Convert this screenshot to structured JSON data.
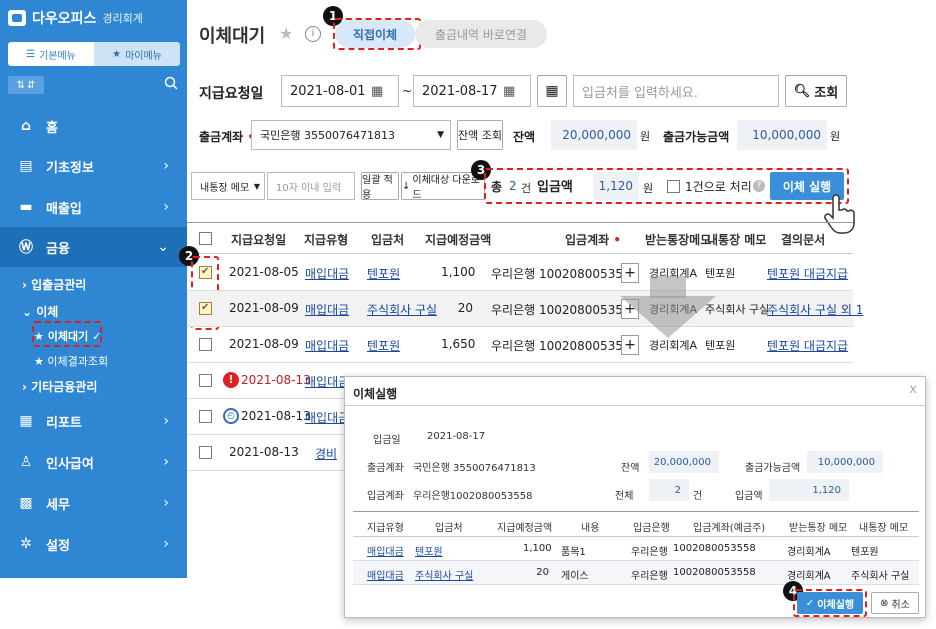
{
  "sidebar": {
    "brand": "다우오피스",
    "brand_sub": "경리회계",
    "tab_basic": "기본메뉴",
    "tab_my": "마이메뉴",
    "nav": [
      {
        "label": "홈",
        "icon": "home-icon"
      },
      {
        "label": "기초정보",
        "icon": "list-icon"
      },
      {
        "label": "매출입",
        "icon": "card-icon"
      },
      {
        "label": "금융",
        "icon": "won-icon"
      },
      {
        "label": "리포트",
        "icon": "report-icon"
      },
      {
        "label": "인사급여",
        "icon": "person-icon"
      },
      {
        "label": "세무",
        "icon": "calculator-icon"
      },
      {
        "label": "설정",
        "icon": "gear-icon"
      }
    ],
    "sub_deposit": "입출금관리",
    "sub_transfer": "이체",
    "sub_transfer_wait": "이체대기",
    "sub_transfer_result": "이체결과조회",
    "sub_other": "기타금융관리"
  },
  "header": {
    "title": "이체대기",
    "tab_direct": "직접이체",
    "tab_history": "출금내역 바로연결"
  },
  "filters": {
    "date_label": "지급요청일",
    "date_from": "2021-08-01",
    "date_to": "2021-08-17",
    "tilde": "~",
    "search_placeholder": "입금처를 입력하세요.",
    "search_button": "조회",
    "account_label": "출금계좌",
    "account_value": "국민은행 3550076471813",
    "balance_button": "잔액 조회",
    "balance_label": "잔액",
    "balance_value": "20,000,000",
    "avail_label": "출금가능금액",
    "avail_value": "10,000,000",
    "won": "원"
  },
  "action_bar": {
    "memo_select": "내통장 메모",
    "memo_placeholder": "10자 이내 입력",
    "apply_button": "일괄 적용",
    "download_button": "이체대상 다운로드",
    "total_label": "총",
    "total_count": "2",
    "count_unit": "건",
    "amount_label": "입금액",
    "amount_value": "1,120",
    "won": "원",
    "single_label": "1건으로 처리",
    "execute_button": "이체 실행"
  },
  "table": {
    "headers": [
      "지급요청일",
      "지급유형",
      "입금처",
      "지급예정금액",
      "입금계좌",
      "받는통장메모",
      "내통장 메모",
      "결의문서"
    ],
    "rows": [
      {
        "date": "2021-08-05",
        "type": "매입대금",
        "payee": "텐포원",
        "amount": "1,100",
        "account": "우리은행 1002080053558",
        "recv_memo": "경리회계A",
        "my_memo": "텐포원",
        "doc": "텐포원 대금지급",
        "checked": true,
        "status": ""
      },
      {
        "date": "2021-08-09",
        "type": "매입대금",
        "payee": "주식회사 구실",
        "amount": "20",
        "account": "우리은행 1002080053558",
        "recv_memo": "경리회계A",
        "my_memo": "주식회사 구실",
        "doc": "주식회사 구실 외 1",
        "checked": true,
        "status": ""
      },
      {
        "date": "2021-08-09",
        "type": "매입대금",
        "payee": "텐포원",
        "amount": "1,650",
        "account": "우리은행 1002080053558",
        "recv_memo": "경리회계A",
        "my_memo": "텐포원",
        "doc": "텐포원 대금지급",
        "checked": false,
        "status": ""
      },
      {
        "date": "2021-08-13",
        "type": "매입대금",
        "payee": "",
        "amount": "",
        "account": "",
        "recv_memo": "",
        "my_memo": "",
        "doc": "",
        "checked": false,
        "status": "error"
      },
      {
        "date": "2021-08-13",
        "type": "매입대금",
        "payee": "",
        "amount": "",
        "account": "",
        "recv_memo": "",
        "my_memo": "",
        "doc": "",
        "checked": false,
        "status": "clock"
      },
      {
        "date": "2021-08-13",
        "type": "경비",
        "payee": "",
        "amount": "",
        "account": "",
        "recv_memo": "",
        "my_memo": "",
        "doc": "",
        "checked": false,
        "status": ""
      }
    ]
  },
  "popup": {
    "title": "이체실행",
    "close": "x",
    "date_label": "입금일",
    "date_value": "2021-08-17",
    "out_account_label": "출금계좌",
    "out_account_value": "국민은행 3550076471813",
    "balance_label": "잔액",
    "balance_value": "20,000,000",
    "avail_label": "출금가능금액",
    "avail_value": "10,000,000",
    "in_account_label": "입금계좌",
    "in_account_value": "우리은행1002080053558",
    "total_label": "전체",
    "total_value": "2",
    "total_unit": "건",
    "amount_label": "입금액",
    "amount_value": "1,120",
    "headers": [
      "지급유형",
      "입금처",
      "지급예정금액",
      "내용",
      "입금은행",
      "입금계좌(예금주)",
      "받는통장 메모",
      "내통장 메모"
    ],
    "rows": [
      {
        "type": "매입대금",
        "payee": "텐포원",
        "amount": "1,100",
        "content": "품목1",
        "bank": "우리은행",
        "account": "1002080053558",
        "recv_memo": "경리회계A",
        "my_memo": "텐포원"
      },
      {
        "type": "매입대금",
        "payee": "주식회사 구실",
        "amount": "20",
        "content": "게이스",
        "bank": "우리은행",
        "account": "1002080053558",
        "recv_memo": "경리회계A",
        "my_memo": "주식회사 구실"
      }
    ],
    "execute_button": "이체실행",
    "cancel_button": "취소"
  },
  "callouts": [
    "1",
    "2",
    "3",
    "4"
  ],
  "colors": {
    "sidebar": "#2f86d3",
    "highlight": "#e02020",
    "button": "#3a8fd8"
  }
}
